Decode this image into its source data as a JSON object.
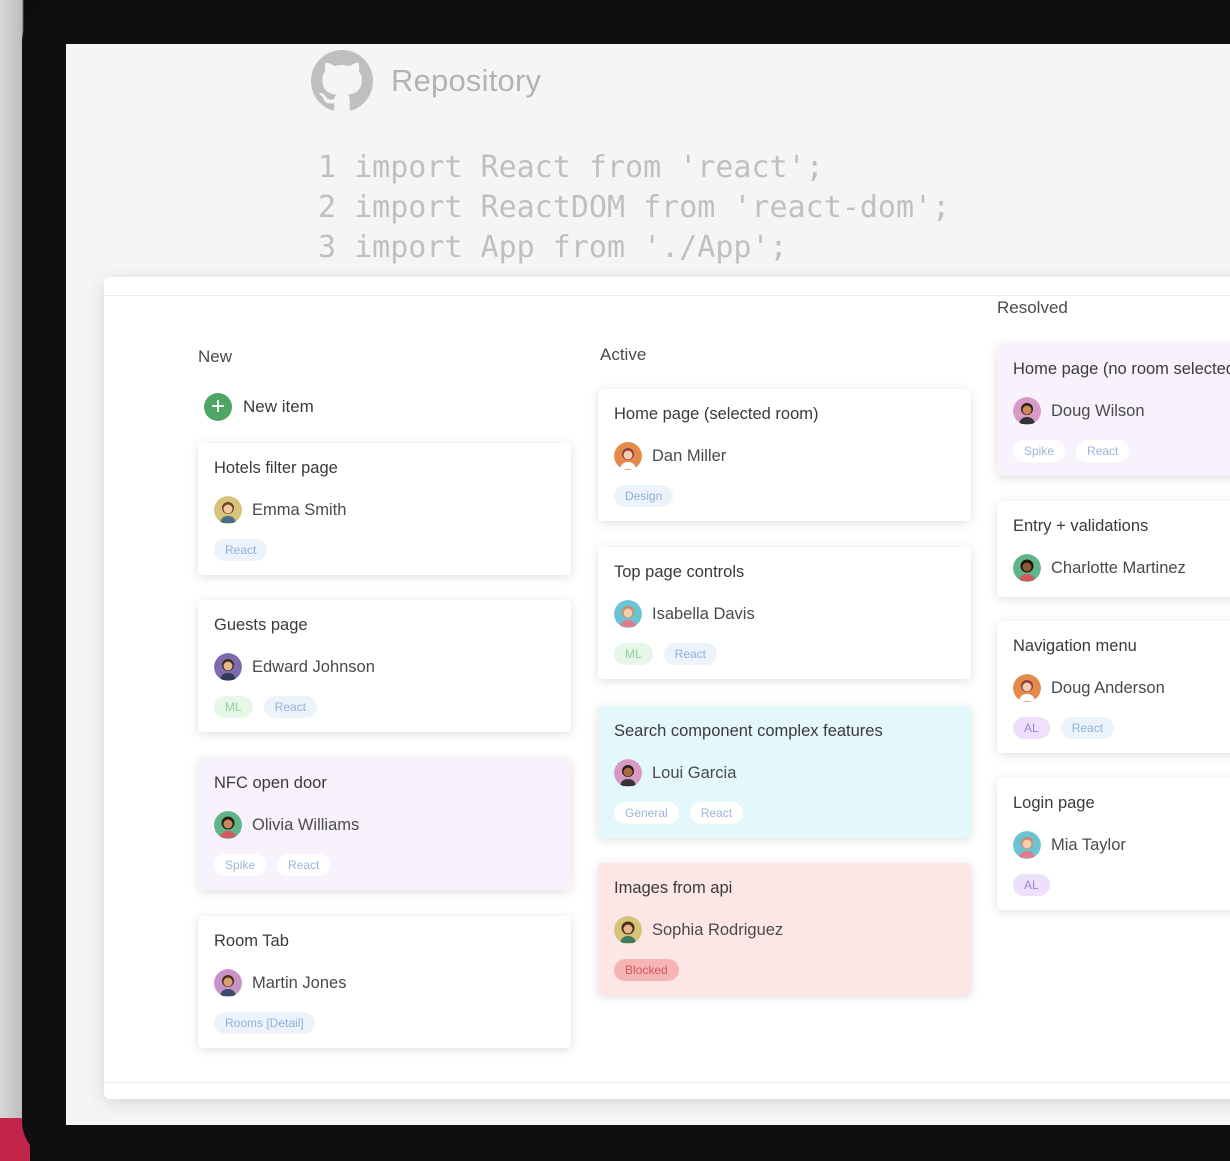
{
  "repository": {
    "title": "Repository",
    "code_lines": [
      "1 import React from 'react';",
      "2 import ReactDOM from 'react-dom';",
      "3 import App from './App';"
    ]
  },
  "board": {
    "columns": {
      "new": {
        "title": "New",
        "new_item_label": "New item",
        "cards": [
          {
            "title": "Hotels filter page",
            "assignee": "Emma Smith",
            "tags": [
              "React"
            ]
          },
          {
            "title": "Guests page",
            "assignee": "Edward Johnson",
            "tags": [
              "ML",
              "React"
            ]
          },
          {
            "title": "NFC open door",
            "assignee": "Olivia Williams",
            "tags": [
              "Spike",
              "React"
            ]
          },
          {
            "title": "Room Tab",
            "assignee": "Martin Jones",
            "tags": [
              "Rooms [Detail]"
            ]
          }
        ]
      },
      "active": {
        "title": "Active",
        "cards": [
          {
            "title": "Home page (selected room)",
            "assignee": "Dan Miller",
            "tags": [
              "Design"
            ]
          },
          {
            "title": "Top page controls",
            "assignee": "Isabella Davis",
            "tags": [
              "ML",
              "React"
            ]
          },
          {
            "title": "Search component complex features",
            "assignee": "Loui Garcia",
            "tags": [
              "General",
              "React"
            ]
          },
          {
            "title": "Images from api",
            "assignee": "Sophia Rodriguez",
            "tags": [
              "Blocked"
            ]
          }
        ]
      },
      "resolved": {
        "title": "Resolved",
        "cards": [
          {
            "title": "Home page (no room selected",
            "assignee": "Doug Wilson",
            "tags": [
              "Spike",
              "React"
            ]
          },
          {
            "title": "Entry + validations",
            "assignee": "Charlotte Martinez",
            "tags": []
          },
          {
            "title": "Navigation menu",
            "assignee": "Doug Anderson",
            "tags": [
              "AL",
              "React"
            ]
          },
          {
            "title": "Login page",
            "assignee": "Mia Taylor",
            "tags": [
              "AL"
            ]
          }
        ]
      }
    }
  },
  "colors": {
    "card_purple": "#f8f2fc",
    "card_cyan": "#e4f7fb",
    "card_pink": "#fde6e6",
    "add_button": "#4fa564"
  },
  "icons": [
    "github-icon",
    "add-icon",
    "avatar"
  ]
}
